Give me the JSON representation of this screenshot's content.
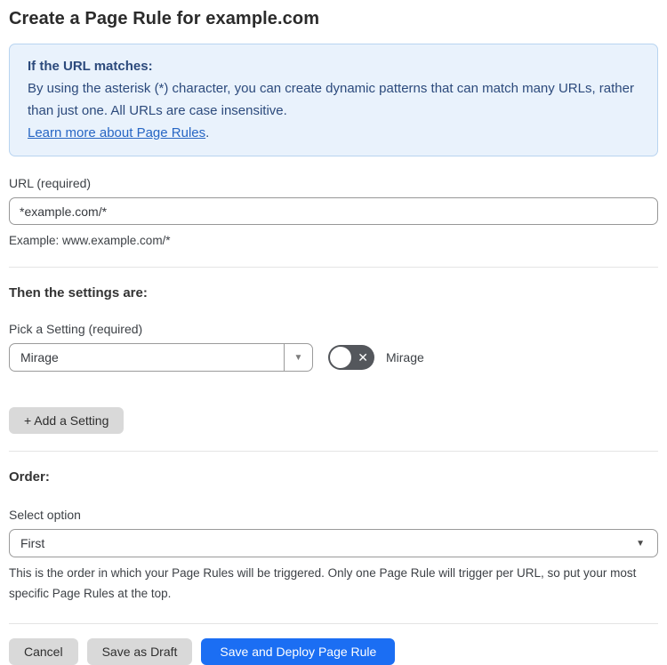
{
  "page": {
    "title": "Create a Page Rule for example.com"
  },
  "info_box": {
    "heading": "If the URL matches:",
    "body": "By using the asterisk (*) character, you can create dynamic patterns that can match many URLs, rather than just one. All URLs are case insensitive.",
    "link_label": "Learn more about Page Rules",
    "link_suffix": "."
  },
  "url_field": {
    "label": "URL (required)",
    "value": "*example.com/*",
    "helper": "Example: www.example.com/*"
  },
  "settings_section": {
    "heading": "Then the settings are:",
    "setting_label": "Pick a Setting (required)",
    "setting_value": "Mirage",
    "toggle_label": "Mirage",
    "toggle_state": "off",
    "add_button_label": "+ Add a Setting"
  },
  "order_section": {
    "heading": "Order:",
    "select_label": "Select option",
    "select_value": "First",
    "helper": "This is the order in which your Page Rules will be triggered. Only one Page Rule will trigger per URL, so put your most specific Page Rules at the top."
  },
  "footer": {
    "cancel_label": "Cancel",
    "save_draft_label": "Save as Draft",
    "save_deploy_label": "Save and Deploy Page Rule"
  },
  "icons": {
    "caret_down": "▼",
    "x_mark": "✕"
  },
  "colors": {
    "accent_blue": "#1b6ef3",
    "info_background": "#e9f2fc",
    "info_border": "#b8d4f0",
    "info_text": "#2c4a7c",
    "link_blue": "#2766c4",
    "toggle_off": "#54575c",
    "gray_button": "#d9d9d9"
  }
}
